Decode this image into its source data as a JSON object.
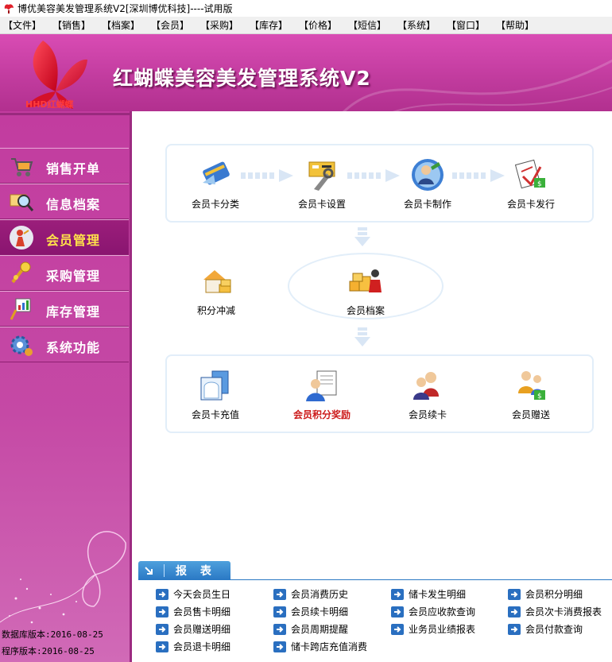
{
  "window": {
    "title": "博优美容美发管理系统V2[深圳博优科技]----试用版"
  },
  "menu": [
    "【文件】",
    "【销售】",
    "【档案】",
    "【会员】",
    "【采购】",
    "【库存】",
    "【价格】",
    "【短信】",
    "【系统】",
    "【窗口】",
    "【帮助】"
  ],
  "header": {
    "logo_text": "HHD红蝴蝶",
    "app_title": "红蝴蝶美容美发管理系统V2"
  },
  "sidebar": {
    "items": [
      {
        "label": "销售开单",
        "icon": "cart-icon"
      },
      {
        "label": "信息档案",
        "icon": "magnifier-icon"
      },
      {
        "label": "会员管理",
        "icon": "member-icon",
        "active": true
      },
      {
        "label": "采购管理",
        "icon": "purchase-icon"
      },
      {
        "label": "库存管理",
        "icon": "stock-icon"
      },
      {
        "label": "系统功能",
        "icon": "gear-icon"
      }
    ],
    "db_version": "数据库版本:2016-08-25",
    "prog_version": "程序版本:2016-08-25"
  },
  "flow": {
    "row1": [
      "会员卡分类",
      "会员卡设置",
      "会员卡制作",
      "会员卡发行"
    ],
    "middle": [
      "积分冲减",
      "会员档案"
    ],
    "row3": [
      "会员卡充值",
      "会员积分奖励",
      "会员续卡",
      "会员赠送"
    ]
  },
  "reports": {
    "title": "报 表",
    "links": [
      [
        "今天会员生日",
        "会员消费历史",
        "储卡发生明细",
        "会员积分明细"
      ],
      [
        "会员售卡明细",
        "会员续卡明细",
        "会员应收款查询",
        "会员次卡消费报表"
      ],
      [
        "会员赠送明细",
        "会员周期提醒",
        "业务员业绩报表",
        "会员付款查询"
      ],
      [
        "会员退卡明细",
        "储卡跨店充值消费"
      ]
    ]
  },
  "colors": {
    "brand_magenta": "#c23c9f",
    "active_text": "#ffe24a",
    "report_blue": "#2a78c4",
    "hot_red": "#cc1a1a"
  }
}
